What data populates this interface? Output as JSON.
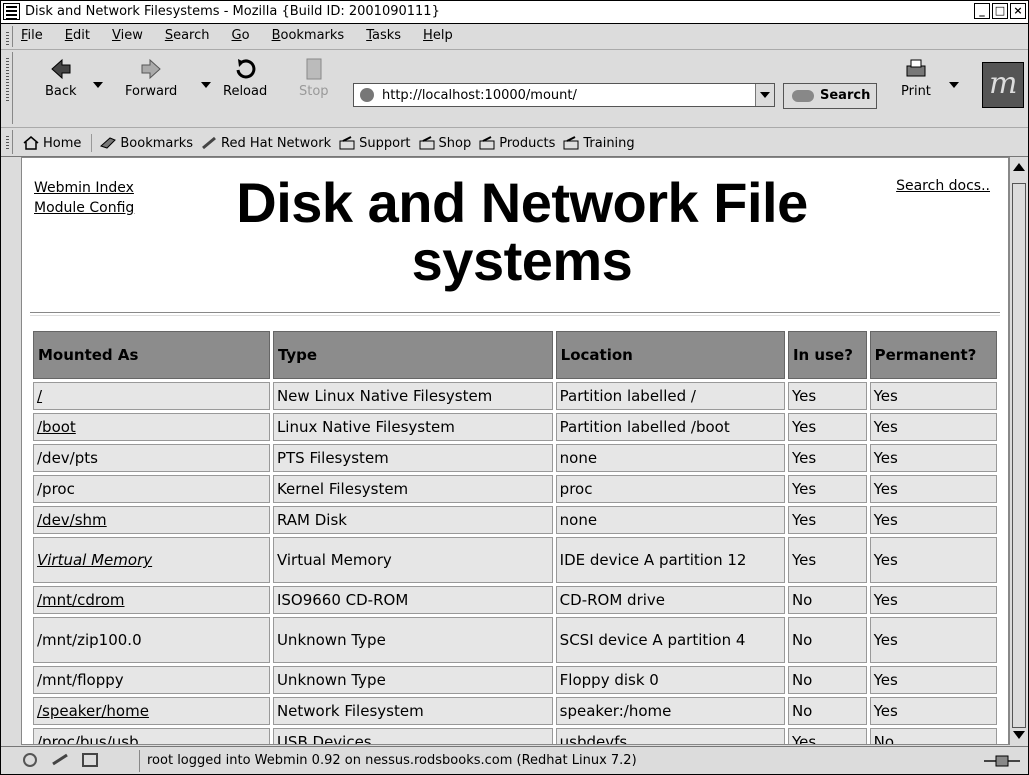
{
  "window": {
    "title": "Disk and Network Filesystems - Mozilla {Build ID: 2001090111}"
  },
  "menubar": {
    "items": [
      "File",
      "Edit",
      "View",
      "Search",
      "Go",
      "Bookmarks",
      "Tasks",
      "Help"
    ]
  },
  "toolbar": {
    "back": "Back",
    "forward": "Forward",
    "reload": "Reload",
    "stop": "Stop",
    "url": "http://localhost:10000/mount/",
    "search": "Search",
    "print": "Print"
  },
  "personal_toolbar": {
    "items": [
      "Home",
      "Bookmarks",
      "Red Hat Network",
      "Support",
      "Shop",
      "Products",
      "Training"
    ]
  },
  "page": {
    "links": {
      "webmin_index": "Webmin Index",
      "module_config": "Module Config",
      "search_docs": "Search docs.."
    },
    "title": "Disk and Network File systems"
  },
  "table": {
    "headers": [
      "Mounted As",
      "Type",
      "Location",
      "In use?",
      "Permanent?"
    ],
    "rows": [
      {
        "mounted": "/",
        "linked": true,
        "italic": false,
        "type": "New Linux Native Filesystem",
        "location": "Partition labelled /",
        "in_use": "Yes",
        "permanent": "Yes"
      },
      {
        "mounted": "/boot",
        "linked": true,
        "italic": false,
        "type": "Linux Native Filesystem",
        "location": "Partition labelled /boot",
        "in_use": "Yes",
        "permanent": "Yes"
      },
      {
        "mounted": "/dev/pts",
        "linked": false,
        "italic": false,
        "type": "PTS Filesystem",
        "location": "none",
        "in_use": "Yes",
        "permanent": "Yes"
      },
      {
        "mounted": "/proc",
        "linked": false,
        "italic": false,
        "type": "Kernel Filesystem",
        "location": "proc",
        "in_use": "Yes",
        "permanent": "Yes"
      },
      {
        "mounted": "/dev/shm",
        "linked": true,
        "italic": false,
        "type": "RAM Disk",
        "location": "none",
        "in_use": "Yes",
        "permanent": "Yes"
      },
      {
        "mounted": "Virtual Memory",
        "linked": true,
        "italic": true,
        "type": "Virtual Memory",
        "location": "IDE device A partition 12",
        "in_use": "Yes",
        "permanent": "Yes"
      },
      {
        "mounted": "/mnt/cdrom",
        "linked": true,
        "italic": false,
        "type": "ISO9660 CD-ROM",
        "location": "CD-ROM drive",
        "in_use": "No",
        "permanent": "Yes"
      },
      {
        "mounted": "/mnt/zip100.0",
        "linked": false,
        "italic": false,
        "type": "Unknown Type",
        "location": "SCSI device A partition 4",
        "in_use": "No",
        "permanent": "Yes"
      },
      {
        "mounted": "/mnt/floppy",
        "linked": false,
        "italic": false,
        "type": "Unknown Type",
        "location": "Floppy disk 0",
        "in_use": "No",
        "permanent": "Yes"
      },
      {
        "mounted": "/speaker/home",
        "linked": true,
        "italic": false,
        "type": "Network Filesystem",
        "location": "speaker:/home",
        "in_use": "No",
        "permanent": "Yes"
      },
      {
        "mounted": "/proc/bus/usb",
        "linked": false,
        "italic": false,
        "type": "USB Devices",
        "location": "usbdevfs",
        "in_use": "Yes",
        "permanent": "No"
      }
    ]
  },
  "statusbar": {
    "text": "root logged into Webmin 0.92 on nessus.rodsbooks.com (Redhat Linux 7.2)"
  },
  "colors": {
    "header_bg": "#8c8c8c",
    "cell_bg": "#e6e6e6",
    "chrome_bg": "#dcdcdc"
  }
}
